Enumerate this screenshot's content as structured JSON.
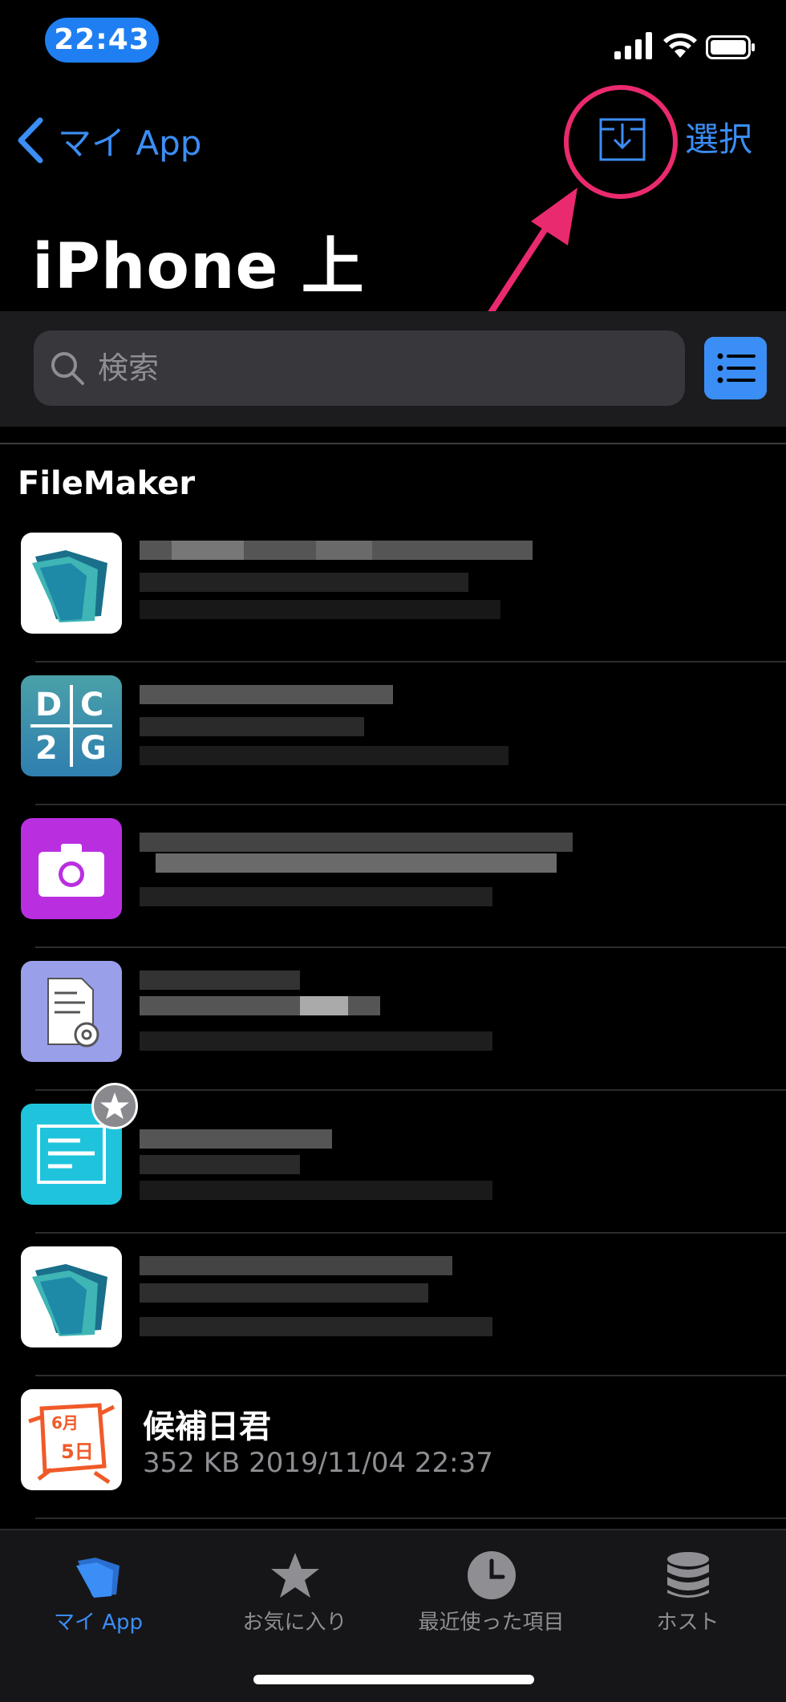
{
  "status_bar": {
    "time": "22:43"
  },
  "nav": {
    "back_label": "マイ App",
    "select_label": "選択"
  },
  "page": {
    "title": "iPhone 上"
  },
  "search": {
    "placeholder": "検索"
  },
  "section": {
    "title": "FileMaker"
  },
  "rows": [
    {
      "icon": "filemaker-folder-icon",
      "title": "",
      "subtitle": ""
    },
    {
      "icon": "dc2g-icon",
      "title": "",
      "subtitle": "",
      "icon_letters": [
        "D",
        "C",
        "2",
        "G"
      ]
    },
    {
      "icon": "camera-icon",
      "title": "",
      "subtitle": ""
    },
    {
      "icon": "document-gear-icon",
      "title": "",
      "subtitle": ""
    },
    {
      "icon": "form-icon",
      "title": "",
      "subtitle": "",
      "badge": "star-badge-icon"
    },
    {
      "icon": "filemaker-folder-icon",
      "title": "",
      "subtitle": ""
    },
    {
      "icon": "calendar-character-icon",
      "title": "候補日君",
      "subtitle": "352 KB 2019/11/04 22:37",
      "icon_text": [
        "6月",
        "5日"
      ]
    }
  ],
  "tabs": [
    {
      "label": "マイ App",
      "icon": "folder-icon",
      "active": true
    },
    {
      "label": "お気に入り",
      "icon": "star-icon",
      "active": false
    },
    {
      "label": "最近使った項目",
      "icon": "clock-icon",
      "active": false
    },
    {
      "label": "ホスト",
      "icon": "database-icon",
      "active": false
    }
  ],
  "colors": {
    "accent": "#3b8ef5",
    "highlight": "#ea2a6e",
    "background": "#000000"
  }
}
